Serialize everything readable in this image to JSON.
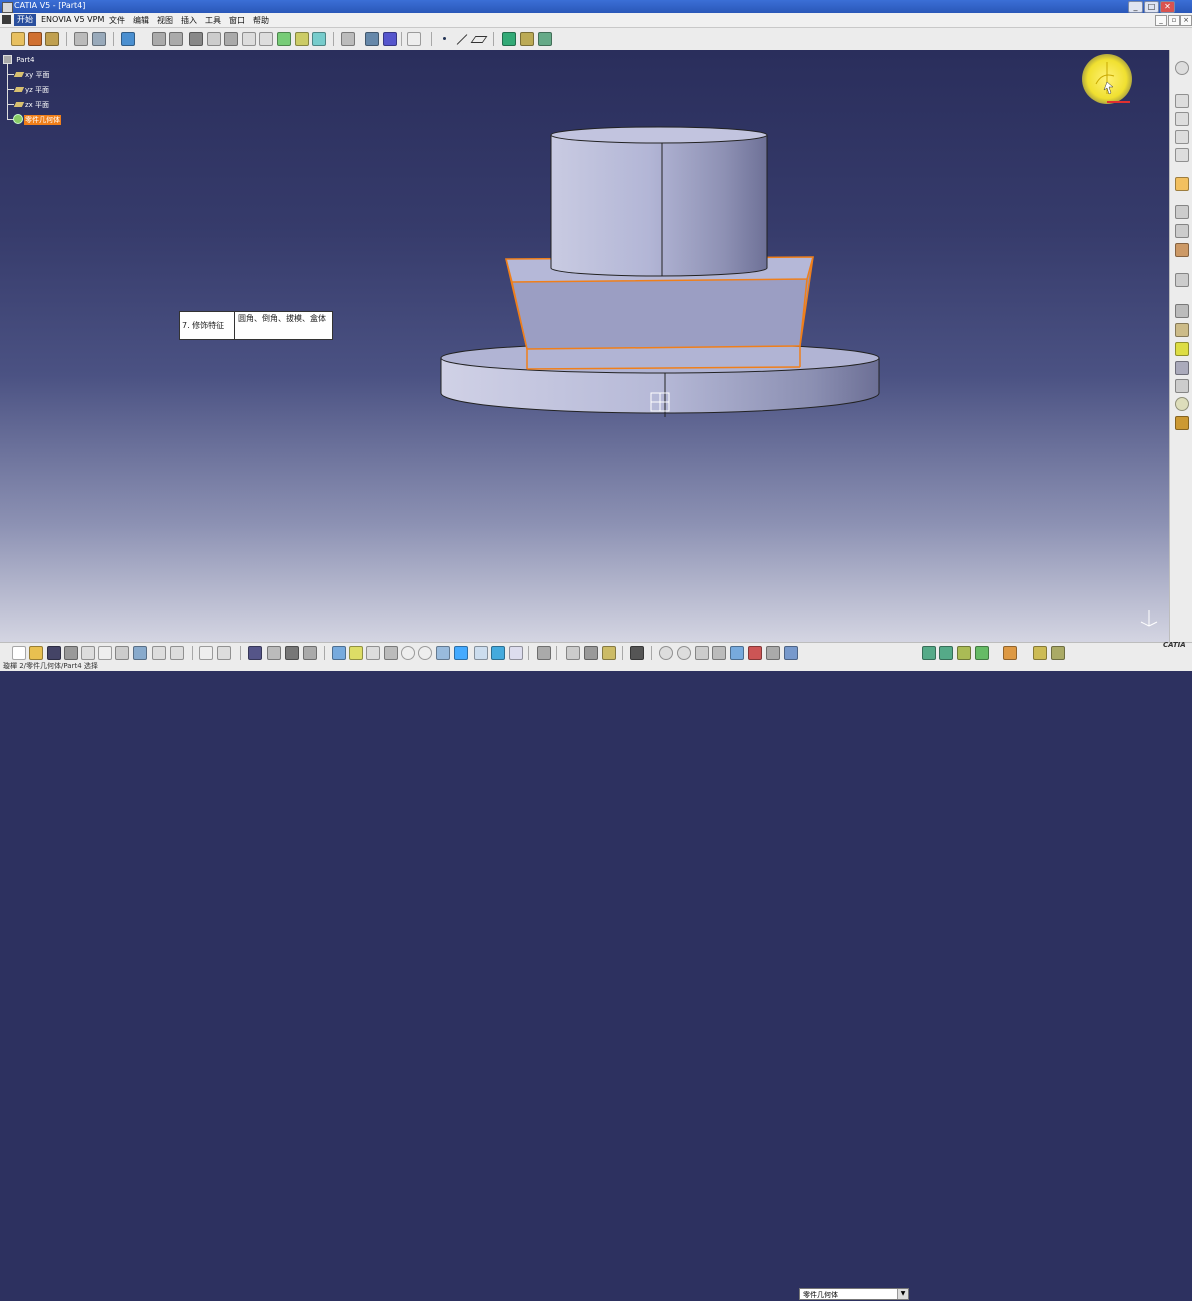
{
  "window": {
    "title": "CATIA V5 - [Part4]"
  },
  "menu": {
    "items": [
      "开始",
      "ENOVIA V5 VPM",
      "文件",
      "编辑",
      "视图",
      "插入",
      "工具",
      "窗口",
      "帮助"
    ]
  },
  "tree": {
    "root": "Part4",
    "planes": [
      "xy 平面",
      "yz 平面",
      "zx 平面"
    ],
    "body": "零件几何体"
  },
  "tooltip": {
    "feature": "7. 修饰特征",
    "desc": "圆角、倒角、拔模、盒体"
  },
  "combo": {
    "value": "零件几何体"
  },
  "status": {
    "text": "璇樿 2/零件几何体/Part4 选择"
  },
  "brand": {
    "logo": "CATIA"
  },
  "colors": {
    "selection": "#f07f1a",
    "model": "#b8bcdc",
    "background_top": "#2a2e5c",
    "compass": "#f0e030"
  },
  "icons": {
    "top_toolbar": [
      "workbench-icon",
      "sketch-icon",
      "pad-icon",
      "pocket-icon",
      "shaft-icon",
      "groove-icon",
      "hole-icon",
      "rib-icon",
      "slot-icon",
      "point-icon",
      "line-icon",
      "plane-icon",
      "measure-icon"
    ],
    "bottom_toolbar": [
      "new-icon",
      "open-icon",
      "save-icon",
      "print-icon",
      "cut-icon",
      "copy-icon",
      "paste-icon",
      "undo-icon",
      "help-icon",
      "formula-icon",
      "fly-icon",
      "fit-all-icon",
      "pan-icon",
      "rotate-icon",
      "zoom-in-icon",
      "zoom-out-icon",
      "normal-view-icon",
      "views-icon",
      "render-style-icon",
      "hide-show-icon",
      "swap-icon"
    ],
    "right_toolbar": [
      "compass-tool-icon",
      "view-icon",
      "select-icon",
      "constraint-icon",
      "dress-up-icon",
      "fillet-icon",
      "chamfer-icon",
      "draft-icon",
      "shell-icon",
      "thickness-icon",
      "body-icon"
    ]
  }
}
